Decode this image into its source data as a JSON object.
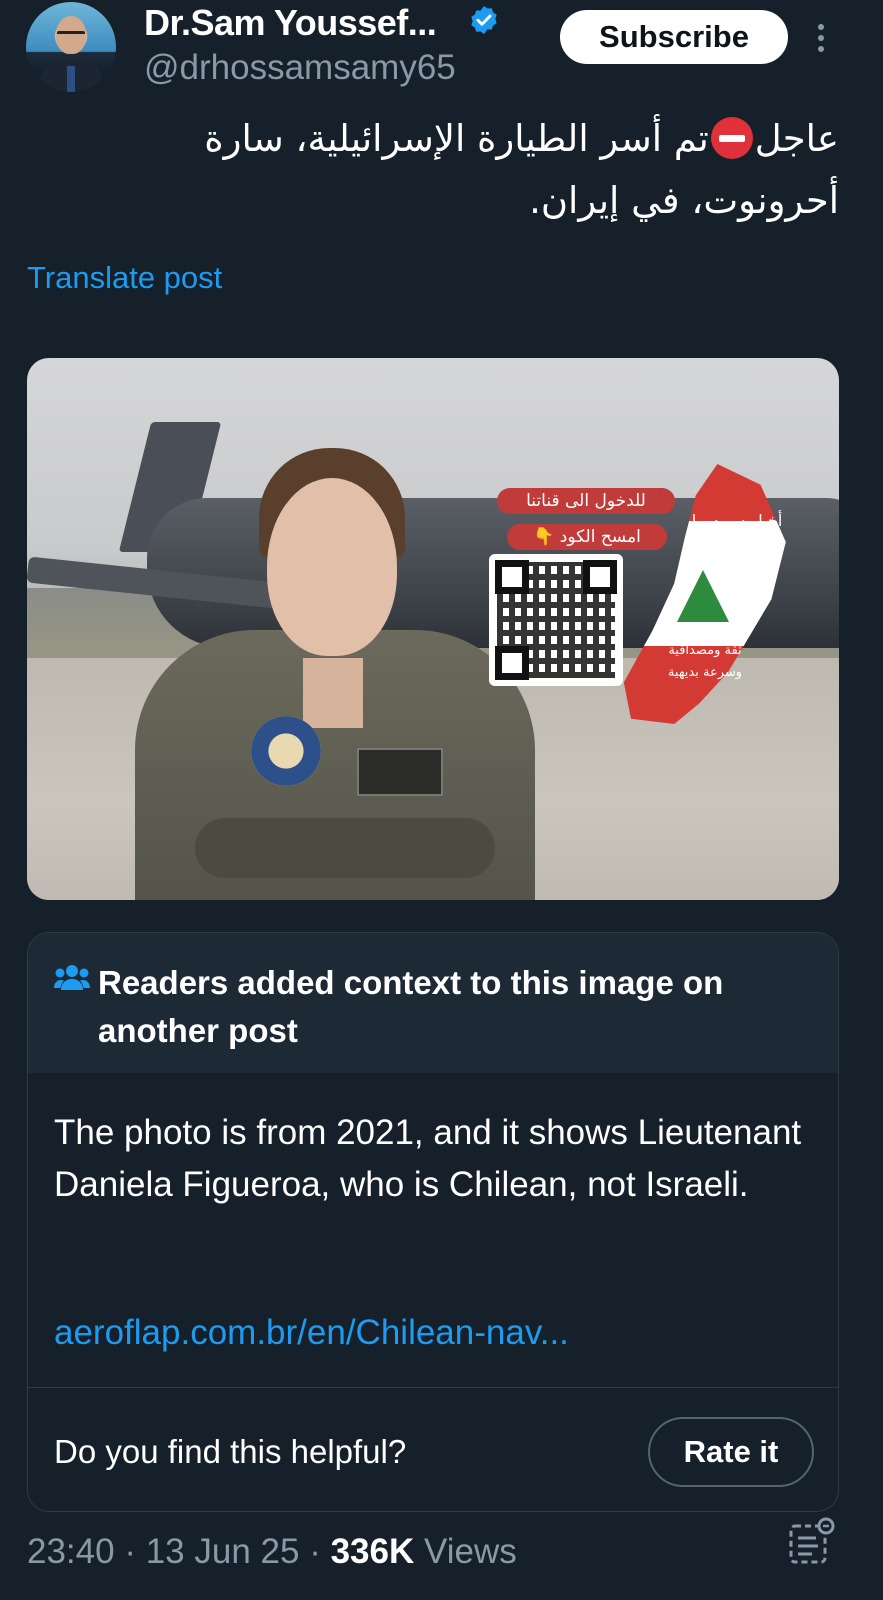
{
  "author": {
    "display_name": "Dr.Sam Youssef...",
    "handle": "@drhossamsamy65",
    "subscribe_label": "Subscribe"
  },
  "post": {
    "text_part1": "عاجل",
    "text_part2": "تم أسر الطيارة الإسرائيلية، سارة أحرونوت، في إيران.",
    "translate_label": "Translate post"
  },
  "media": {
    "overlay_line1": "للدخول الى قناتنا",
    "overlay_line2": "امسح الكود 👇",
    "map_brand": "أخبار سويسرا الشرق",
    "map_tagline": "ثقة ومصداقية وسرعة بديهية"
  },
  "community_note": {
    "title": "Readers added context to this image on another post",
    "body": "The photo is from 2021, and it shows Lieutenant Daniela Figueroa, who is Chilean, not Israeli.",
    "link": "aeroflap.com.br/en/Chilean-nav...",
    "helpful_question": "Do you find this helpful?",
    "rate_label": "Rate it"
  },
  "footer": {
    "time": "23:40",
    "date": "13 Jun 25",
    "views_count": "336K",
    "views_label": "Views"
  },
  "colors": {
    "background": "#15202b",
    "accent": "#1d9bf0",
    "muted": "#8b98a5"
  },
  "icons": [
    "verified-badge-icon",
    "more-options-icon",
    "stop-sign-emoji",
    "people-icon",
    "analytics-icon"
  ]
}
